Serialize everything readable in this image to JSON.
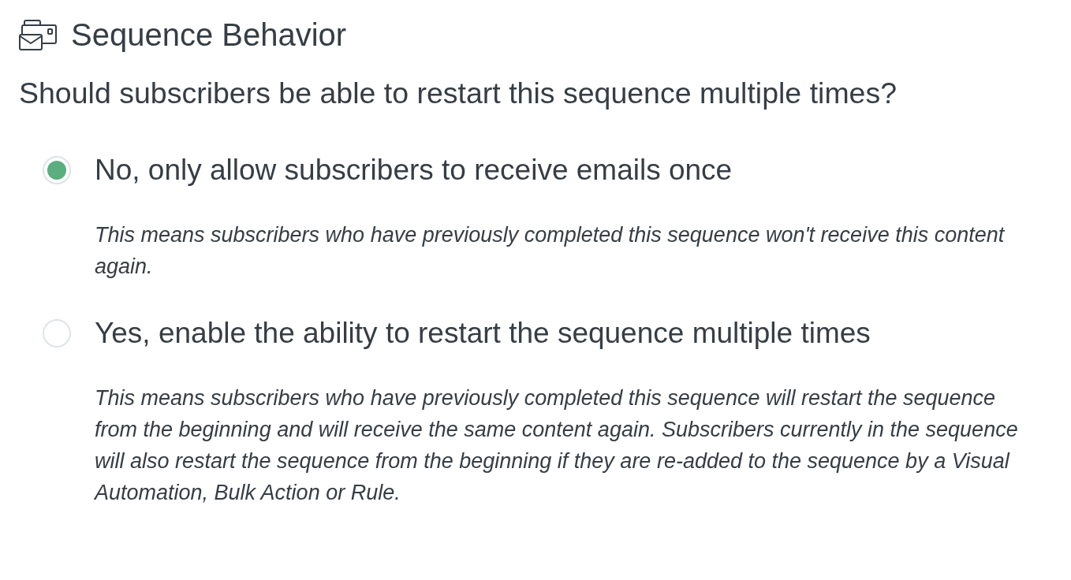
{
  "section": {
    "title": "Sequence Behavior"
  },
  "question": "Should subscribers be able to restart this sequence multiple times?",
  "options": [
    {
      "label": "No, only allow subscribers to receive emails once",
      "description": "This means subscribers who have previously completed this sequence won't receive this content again.",
      "selected": true
    },
    {
      "label": "Yes, enable the ability to restart the sequence multiple times",
      "description": "This means subscribers who have previously completed this sequence will restart the sequence from the beginning and will receive the same content again. Subscribers currently in the sequence will also restart the sequence from the beginning if they are re-added to the sequence by a Visual Automation, Bulk Action or Rule.",
      "selected": false
    }
  ]
}
